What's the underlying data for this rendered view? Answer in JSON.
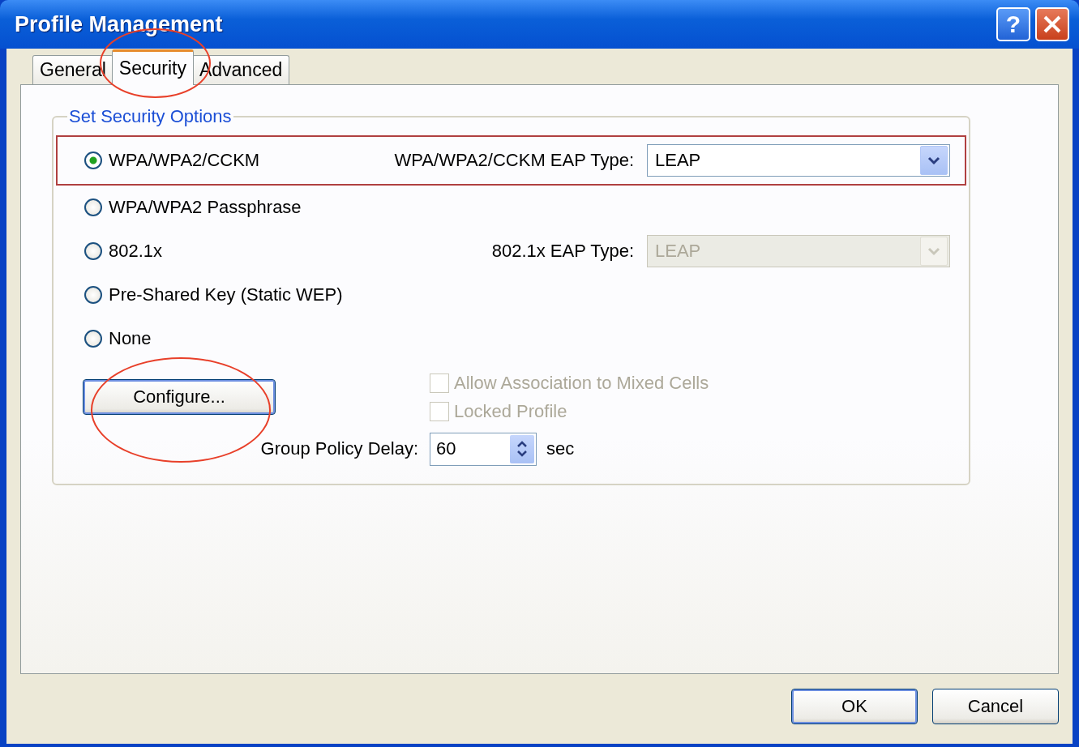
{
  "window": {
    "title": "Profile Management",
    "help_button": "?"
  },
  "tabs": [
    {
      "label": "General",
      "selected": false,
      "circled": false
    },
    {
      "label": "Security",
      "selected": true,
      "circled": true
    },
    {
      "label": "Advanced",
      "selected": false,
      "circled": false
    }
  ],
  "security_group": {
    "title": "Set Security Options",
    "options": [
      {
        "label": "WPA/WPA2/CCKM",
        "selected": true,
        "highlighted": true,
        "eap": {
          "label": "WPA/WPA2/CCKM EAP Type:",
          "value": "LEAP",
          "disabled": false
        }
      },
      {
        "label": "WPA/WPA2 Passphrase",
        "selected": false,
        "highlighted": false
      },
      {
        "label": "802.1x",
        "selected": false,
        "highlighted": false,
        "eap": {
          "label": "802.1x EAP Type:",
          "value": "LEAP",
          "disabled": true
        }
      },
      {
        "label": "Pre-Shared Key (Static WEP)",
        "selected": false,
        "highlighted": false
      },
      {
        "label": "None",
        "selected": false,
        "highlighted": false
      }
    ]
  },
  "configure_button": {
    "label": "Configure...",
    "circled": true
  },
  "checkboxes": [
    {
      "label": "Allow Association to Mixed Cells",
      "checked": false,
      "disabled": true
    },
    {
      "label": "Locked Profile",
      "checked": false,
      "disabled": true
    }
  ],
  "group_policy_delay": {
    "label": "Group Policy Delay:",
    "value": "60",
    "unit": "sec"
  },
  "buttons": [
    {
      "label": "OK",
      "default": true
    },
    {
      "label": "Cancel",
      "default": false
    }
  ]
}
